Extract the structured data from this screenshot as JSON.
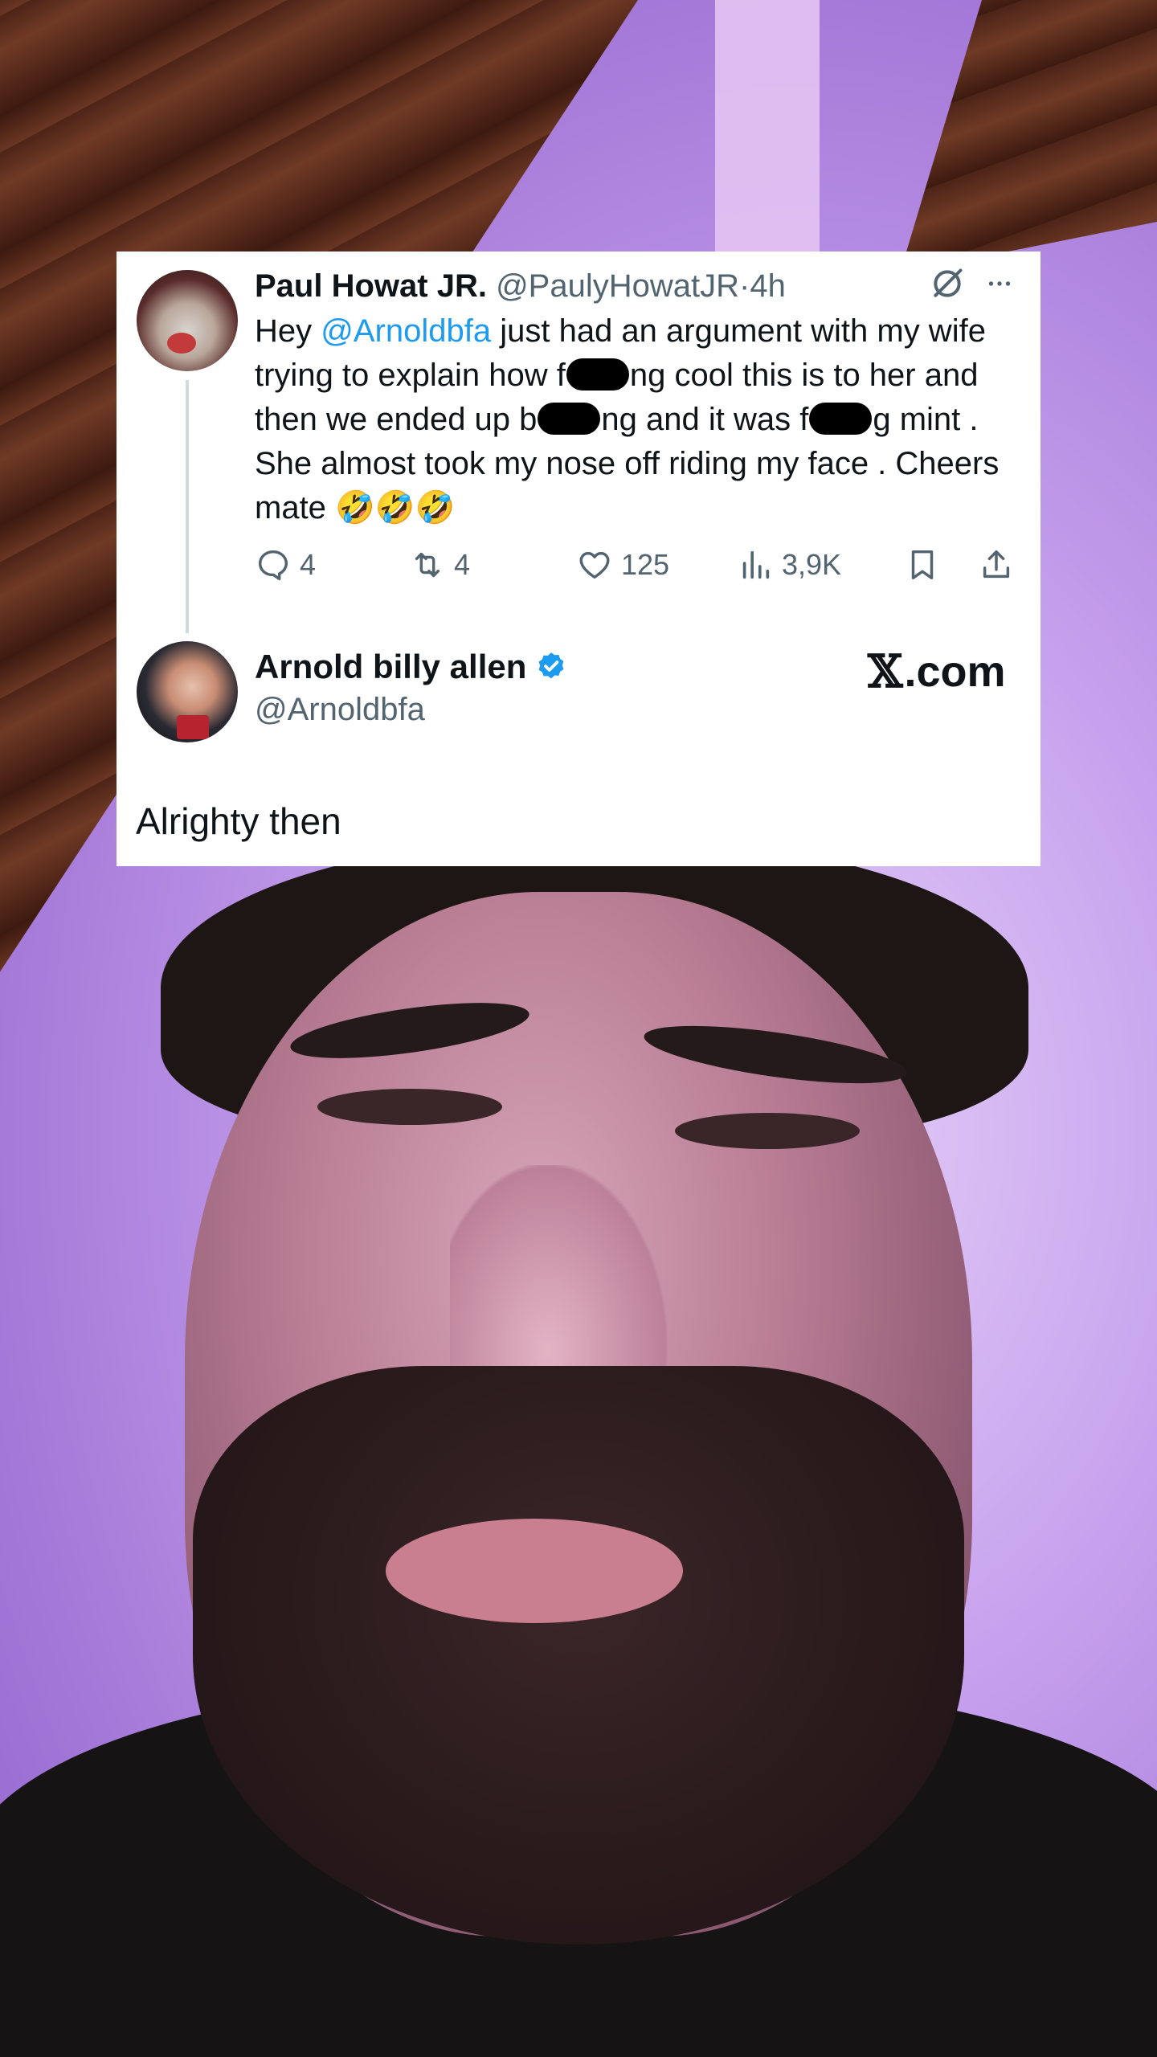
{
  "tweet_1": {
    "author_name": "Paul Howat JR.",
    "handle": "@PaulyHowatJR",
    "separator": "·",
    "time": "4h",
    "text_parts": {
      "hey": "Hey ",
      "mention": "@Arnoldbfa",
      "p1": " just had an argument with my wife trying to explain how f",
      "p2": "ng cool this is to her and then we ended up b",
      "p3": "ng and it was f",
      "p4": "g mint  . She almost took my nose off riding my face . Cheers mate ",
      "emojis": "🤣🤣🤣"
    },
    "replies": "4",
    "reposts": "4",
    "likes": "125",
    "views": "3,9K"
  },
  "tweet_2": {
    "author_name": "Arnold billy allen",
    "handle": "@Arnoldbfa",
    "text": "Alrighty then"
  },
  "watermark": {
    "glyph": "𝕏",
    "text": ".com"
  },
  "colors": {
    "link": "#1d9bf0",
    "secondary_text": "#536471",
    "verified": "#1d9bf0"
  },
  "icons": [
    "grok-icon",
    "more-icon",
    "reply-icon",
    "repost-icon",
    "like-icon",
    "views-icon",
    "bookmark-icon",
    "share-icon",
    "verified-badge-icon"
  ]
}
